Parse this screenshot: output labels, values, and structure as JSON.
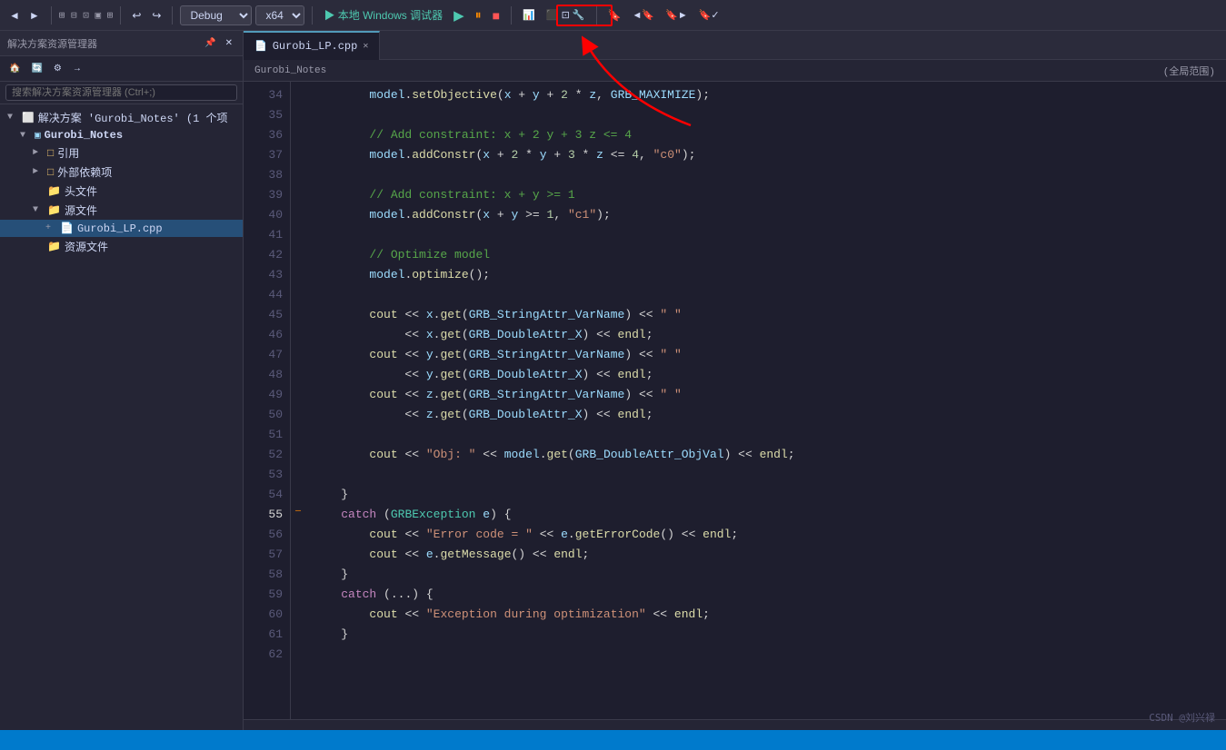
{
  "toolbar": {
    "back_btn": "◄",
    "forward_btn": "►",
    "undo_btn": "↩",
    "redo_btn": "↪",
    "config_label": "Debug",
    "platform_label": "x64",
    "run_label": "▶ 本地 Windows 调试器",
    "play_icon": "▶",
    "bookmark_icon": "🔖",
    "search_icon": "🔍"
  },
  "sidebar": {
    "header": "解决方案资源管理器",
    "search_placeholder": "搜索解决方案资源管理器 (Ctrl+;)",
    "items": [
      {
        "label": "解决方案 'Gurobi_Notes' (1 个项",
        "indent": 0,
        "icon": "folder",
        "expanded": true
      },
      {
        "label": "Gurobi_Notes",
        "indent": 1,
        "icon": "project",
        "expanded": true
      },
      {
        "label": "引用",
        "indent": 2,
        "icon": "folder",
        "expanded": false
      },
      {
        "label": "外部依赖项",
        "indent": 2,
        "icon": "folder",
        "expanded": false
      },
      {
        "label": "头文件",
        "indent": 2,
        "icon": "folder",
        "expanded": false
      },
      {
        "label": "源文件",
        "indent": 2,
        "icon": "folder",
        "expanded": true
      },
      {
        "label": "Gurobi_LP.cpp",
        "indent": 3,
        "icon": "cpp",
        "active": true
      },
      {
        "label": "资源文件",
        "indent": 2,
        "icon": "folder",
        "expanded": false
      }
    ]
  },
  "editor": {
    "tab_label": "Gurobi_LP.cpp",
    "breadcrumb": "Gurobi_Notes",
    "scope": "(全局范围)",
    "lines": [
      {
        "num": 34,
        "code": "        model.setObjective(x + y + 2 * z, GRB_MAXIMIZE);",
        "type": "code"
      },
      {
        "num": 35,
        "code": "",
        "type": "empty"
      },
      {
        "num": 36,
        "code": "        // Add constraint: x + 2 y + 3 z <= 4",
        "type": "comment"
      },
      {
        "num": 37,
        "code": "        model.addConstr(x + 2 * y + 3 * z <= 4, \"c0\");",
        "type": "code"
      },
      {
        "num": 38,
        "code": "",
        "type": "empty"
      },
      {
        "num": 39,
        "code": "        // Add constraint: x + y >= 1",
        "type": "comment"
      },
      {
        "num": 40,
        "code": "        model.addConstr(x + y >= 1, \"c1\");",
        "type": "code"
      },
      {
        "num": 41,
        "code": "",
        "type": "empty"
      },
      {
        "num": 42,
        "code": "        // Optimize model",
        "type": "comment"
      },
      {
        "num": 43,
        "code": "        model.optimize();",
        "type": "code"
      },
      {
        "num": 44,
        "code": "",
        "type": "empty"
      },
      {
        "num": 45,
        "code": "        cout << x.get(GRB_StringAttr_VarName) << \" \"",
        "type": "code"
      },
      {
        "num": 46,
        "code": "             << x.get(GRB_DoubleAttr_X) << endl;",
        "type": "code"
      },
      {
        "num": 47,
        "code": "        cout << y.get(GRB_StringAttr_VarName) << \" \"",
        "type": "code"
      },
      {
        "num": 48,
        "code": "             << y.get(GRB_DoubleAttr_X) << endl;",
        "type": "code"
      },
      {
        "num": 49,
        "code": "        cout << z.get(GRB_StringAttr_VarName) << \" \"",
        "type": "code"
      },
      {
        "num": 50,
        "code": "             << z.get(GRB_DoubleAttr_X) << endl;",
        "type": "code"
      },
      {
        "num": 51,
        "code": "",
        "type": "empty"
      },
      {
        "num": 52,
        "code": "        cout << \"Obj: \" << model.get(GRB_DoubleAttr_ObjVal) << endl;",
        "type": "code"
      },
      {
        "num": 53,
        "code": "",
        "type": "empty"
      },
      {
        "num": 54,
        "code": "    }",
        "type": "code"
      },
      {
        "num": 55,
        "code": "    catch (GRBException e) {",
        "type": "catch",
        "has_gutter": true
      },
      {
        "num": 56,
        "code": "        cout << \"Error code = \" << e.getErrorCode() << endl;",
        "type": "code"
      },
      {
        "num": 57,
        "code": "        cout << e.getMessage() << endl;",
        "type": "code"
      },
      {
        "num": 58,
        "code": "    }",
        "type": "code"
      },
      {
        "num": 59,
        "code": "    catch (...) {",
        "type": "catch"
      },
      {
        "num": 60,
        "code": "        cout << \"Exception during optimization\" << endl;",
        "type": "code"
      },
      {
        "num": 61,
        "code": "    }",
        "type": "code"
      },
      {
        "num": 62,
        "code": "",
        "type": "empty"
      }
    ]
  },
  "watermark": "CSDN @刘兴禄",
  "status_bar": {
    "left": "",
    "right": []
  }
}
